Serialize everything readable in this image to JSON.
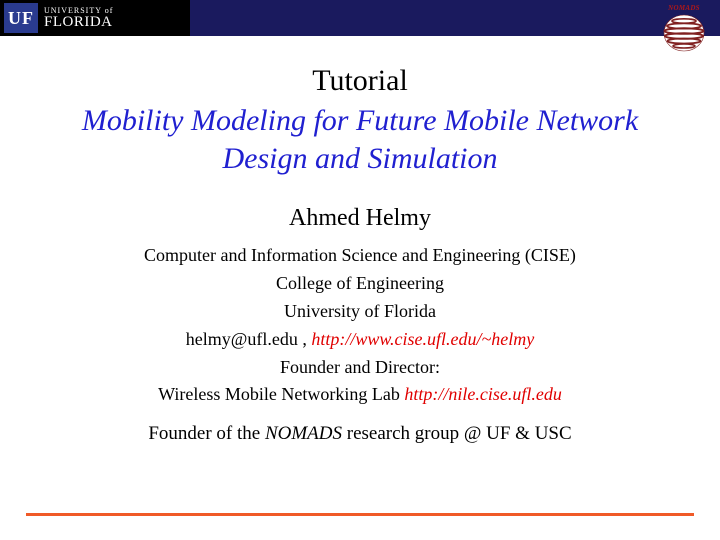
{
  "banner": {
    "uf_initials": "UF",
    "uf_small": "UNIVERSITY of",
    "uf_big": "FLORIDA"
  },
  "nomads": {
    "label": "NOMADS"
  },
  "slide": {
    "tutorial_label": "Tutorial",
    "title_line1": "Mobility Modeling for Future Mobile Network",
    "title_line2": "Design and Simulation",
    "author": "Ahmed Helmy",
    "dept": "Computer and Information Science and Engineering (CISE)",
    "college": "College of Engineering",
    "university": "University of Florida",
    "email_prefix": "helmy@ufl.edu , ",
    "homepage": "http://www.cise.ufl.edu/~helmy",
    "founder_line": "Founder and Director:",
    "lab_prefix": "Wireless Mobile Networking Lab ",
    "lab_url": "http://nile.cise.ufl.edu",
    "group_prefix": "Founder of the ",
    "group_name": "NOMADS",
    "group_suffix": " research group @ UF & USC"
  }
}
